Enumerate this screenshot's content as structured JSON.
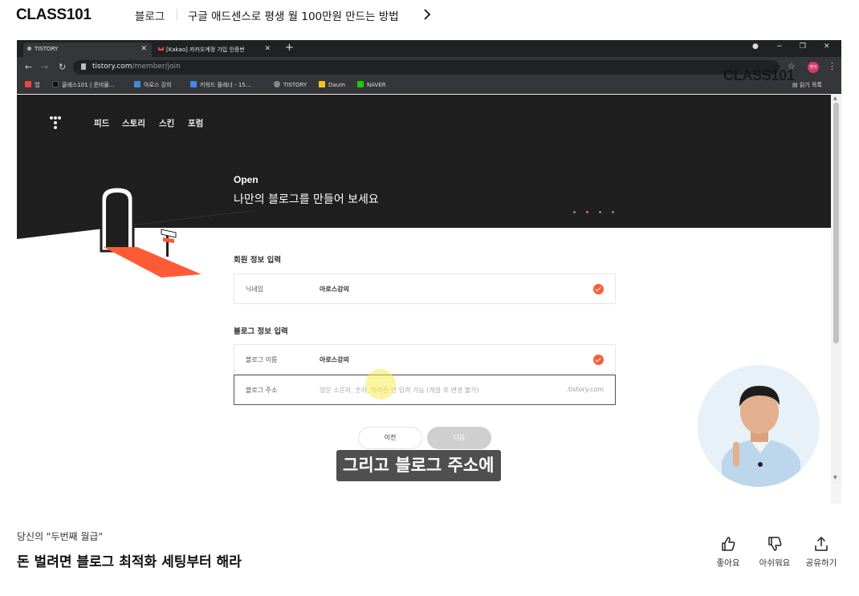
{
  "header": {
    "logo": "CLASS101",
    "breadcrumb_category": "블로그",
    "breadcrumb_title": "구글 애드센스로 평생 월 100만원 만드는 방법"
  },
  "browser": {
    "tabs": [
      {
        "label": "TISTORY",
        "active": true
      },
      {
        "label": "[Kakao] 카카오계정 가입 인증번",
        "active": false
      }
    ],
    "url_host": "tistory.com",
    "url_path": "/member/join",
    "profile_label": "편아",
    "bookmarks": [
      "앱",
      "클래스101 | 준비물...",
      "아로스 강의",
      "키워드 플래너 - 15...",
      "TISTORY",
      "Daum",
      "NAVER"
    ],
    "reading_list": "읽기 목록",
    "watermark": "CLASS101"
  },
  "tistory": {
    "nav": [
      "피드",
      "스토리",
      "스킨",
      "포럼"
    ],
    "hero_label": "Open",
    "hero_sub": "나만의 블로그를 만들어 보세요",
    "member_section": "회원 정보 입력",
    "nickname_label": "닉네임",
    "nickname_value": "아로스강의",
    "blog_section": "블로그 정보 입력",
    "blog_name_label": "블로그 이름",
    "blog_name_value": "아로스강의",
    "blog_addr_label": "블로그 주소",
    "blog_addr_placeholder": "영문 소문자, 숫자, 하이픈 만 입력 가능 (개설 후 변경 불가)",
    "blog_addr_suffix": ".tistory.com",
    "prev_button": "이전",
    "next_button": "다음"
  },
  "video": {
    "subtitle": "그리고 블로그 주소에"
  },
  "lesson": {
    "course": "당신의 \"두번째 월급\"",
    "title": "돈 벌려면 블로그 최적화 세팅부터 해라"
  },
  "actions": {
    "like": "좋아요",
    "dislike": "아쉬워요",
    "share": "공유하기"
  },
  "colors": {
    "accent": "#ff5a36",
    "hero_bg": "#1f1f1f"
  }
}
